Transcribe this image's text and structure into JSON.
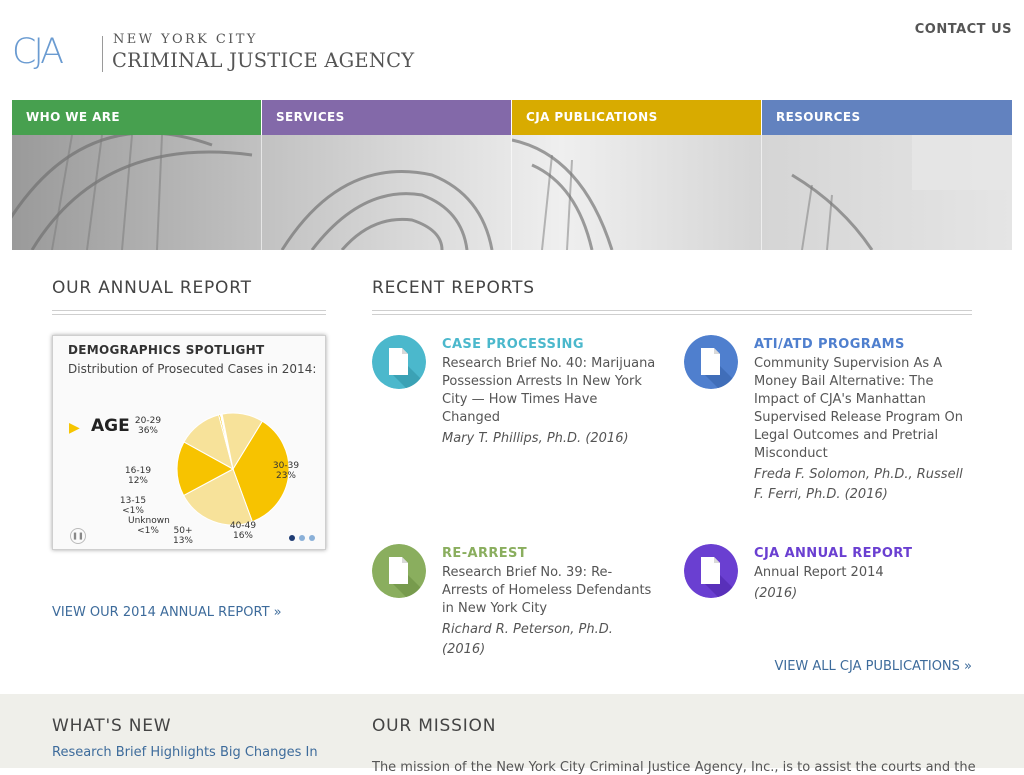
{
  "header": {
    "logo_mark": "CJA",
    "logo_line1": "NEW YORK CITY",
    "logo_line2": "CRIMINAL JUSTICE AGENCY",
    "contact_label": "CONTACT US"
  },
  "nav": {
    "tabs": [
      {
        "label": "WHO WE ARE",
        "color": "#47a04f"
      },
      {
        "label": "SERVICES",
        "color": "#8369a9"
      },
      {
        "label": "CJA PUBLICATIONS",
        "color": "#d8ab00"
      },
      {
        "label": "RESOURCES",
        "color": "#6282bf"
      }
    ]
  },
  "annual": {
    "title": "OUR ANNUAL REPORT",
    "card_title": "DEMOGRAPHICS SPOTLIGHT",
    "card_subtitle": "Distribution of Prosecuted Cases in 2014:",
    "category": "AGE",
    "link": "VIEW OUR 2014 ANNUAL REPORT »"
  },
  "chart_data": {
    "type": "pie",
    "title": "",
    "slices": [
      {
        "label": "20-29",
        "value": 36,
        "display": "36%",
        "color": "#f7c300"
      },
      {
        "label": "30-39",
        "value": 23,
        "display": "23%",
        "color": "#f7e29a"
      },
      {
        "label": "40-49",
        "value": 16,
        "display": "16%",
        "color": "#f7c300"
      },
      {
        "label": "50+",
        "value": 13,
        "display": "13%",
        "color": "#f7e29a"
      },
      {
        "label": "Unknown",
        "value": 0.5,
        "display": "<1%",
        "color": "#f7c300"
      },
      {
        "label": "13-15",
        "value": 0.5,
        "display": "<1%",
        "color": "#ffffff"
      },
      {
        "label": "16-19",
        "value": 12,
        "display": "12%",
        "color": "#f7e29a"
      }
    ]
  },
  "recent": {
    "title": "RECENT REPORTS",
    "items": [
      {
        "category": "CASE PROCESSING",
        "color": "#4bb8cc",
        "dark": "#2f8fa2",
        "desc": "Research Brief No. 40: Marijuana Possession Arrests In New York City — How Times Have Changed",
        "author": "Mary T. Phillips, Ph.D. (2016)"
      },
      {
        "category": "ATI/ATD PROGRAMS",
        "color": "#4f7fce",
        "dark": "#3560a8",
        "desc": "Community Supervision As A Money Bail Alternative: The Impact of CJA's Manhattan Supervised Release Program On Legal Outcomes and Pretrial Misconduct",
        "author": "Freda F. Solomon, Ph.D., Russell F. Ferri, Ph.D. (2016)"
      },
      {
        "category": "RE-ARREST",
        "color": "#8aae5e",
        "dark": "#688c3f",
        "desc": "Research Brief No. 39: Re-Arrests of Homeless Defendants in New York City",
        "author": "Richard R. Peterson, Ph.D. (2016)"
      },
      {
        "category": "CJA ANNUAL REPORT",
        "color": "#6a3fd1",
        "dark": "#4b25a8",
        "desc": "Annual Report 2014",
        "author": "(2016)"
      }
    ],
    "all_link": "VIEW ALL CJA PUBLICATIONS »"
  },
  "whats_new": {
    "title": "WHAT'S NEW",
    "link": "Research Brief Highlights Big Changes In"
  },
  "mission": {
    "title": "OUR MISSION",
    "text": "The mission of the New York City Criminal Justice Agency, Inc., is to assist the courts and the"
  }
}
